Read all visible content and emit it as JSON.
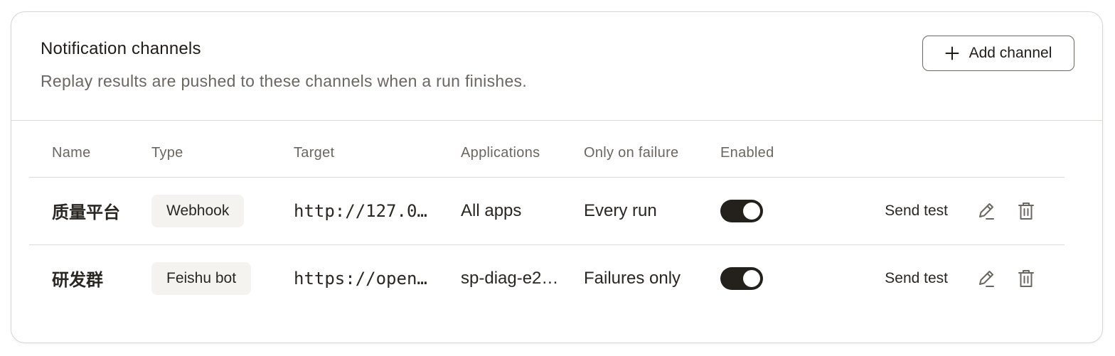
{
  "panel": {
    "title": "Notification channels",
    "subtitle": "Replay results are pushed to these channels when a run finishes.",
    "add_button_label": "Add channel"
  },
  "table": {
    "columns": [
      "Name",
      "Type",
      "Target",
      "Applications",
      "Only on failure",
      "Enabled",
      ""
    ],
    "rows": [
      {
        "name": "质量平台",
        "type": "Webhook",
        "target": "http://127.0…",
        "applications": "All apps",
        "only_on_failure": "Every run",
        "enabled": true,
        "send_test_label": "Send test"
      },
      {
        "name": "研发群",
        "type": "Feishu bot",
        "target": "https://open…",
        "applications": "sp-diag-e2…",
        "only_on_failure": "Failures only",
        "enabled": true,
        "send_test_label": "Send test"
      }
    ]
  },
  "icons": {
    "add": "plus-icon",
    "edit": "pencil-icon",
    "delete": "trash-icon"
  },
  "colors": {
    "toggle_on": "#24211d",
    "muted_text": "#6b665f",
    "badge_bg": "#f4f3f0"
  }
}
